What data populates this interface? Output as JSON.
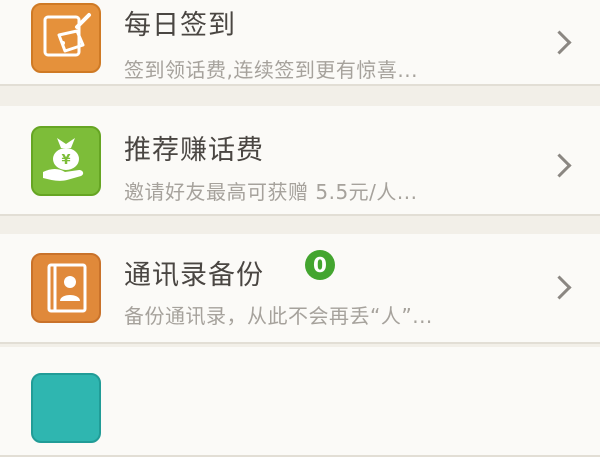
{
  "list": {
    "items": [
      {
        "title": "每日签到",
        "subtitle": "签到领话费,连续签到更有惊喜...",
        "icon": "signin-tag-icon",
        "icon_color": "#e5913b"
      },
      {
        "title": "推荐赚话费",
        "subtitle": "邀请好友最高可获赠 5.5元/人...",
        "icon": "money-bag-hand-icon",
        "icon_color": "#7dbd39"
      },
      {
        "title": "通讯录备份",
        "subtitle": "备份通讯录，从此不会再丢“人”...",
        "icon": "contact-book-icon",
        "icon_color": "#e0893a",
        "badge": "0",
        "badge_color": "#43a52f"
      },
      {
        "title": "",
        "icon": "partial-item-icon",
        "icon_color": "#2fb6b0"
      }
    ]
  }
}
